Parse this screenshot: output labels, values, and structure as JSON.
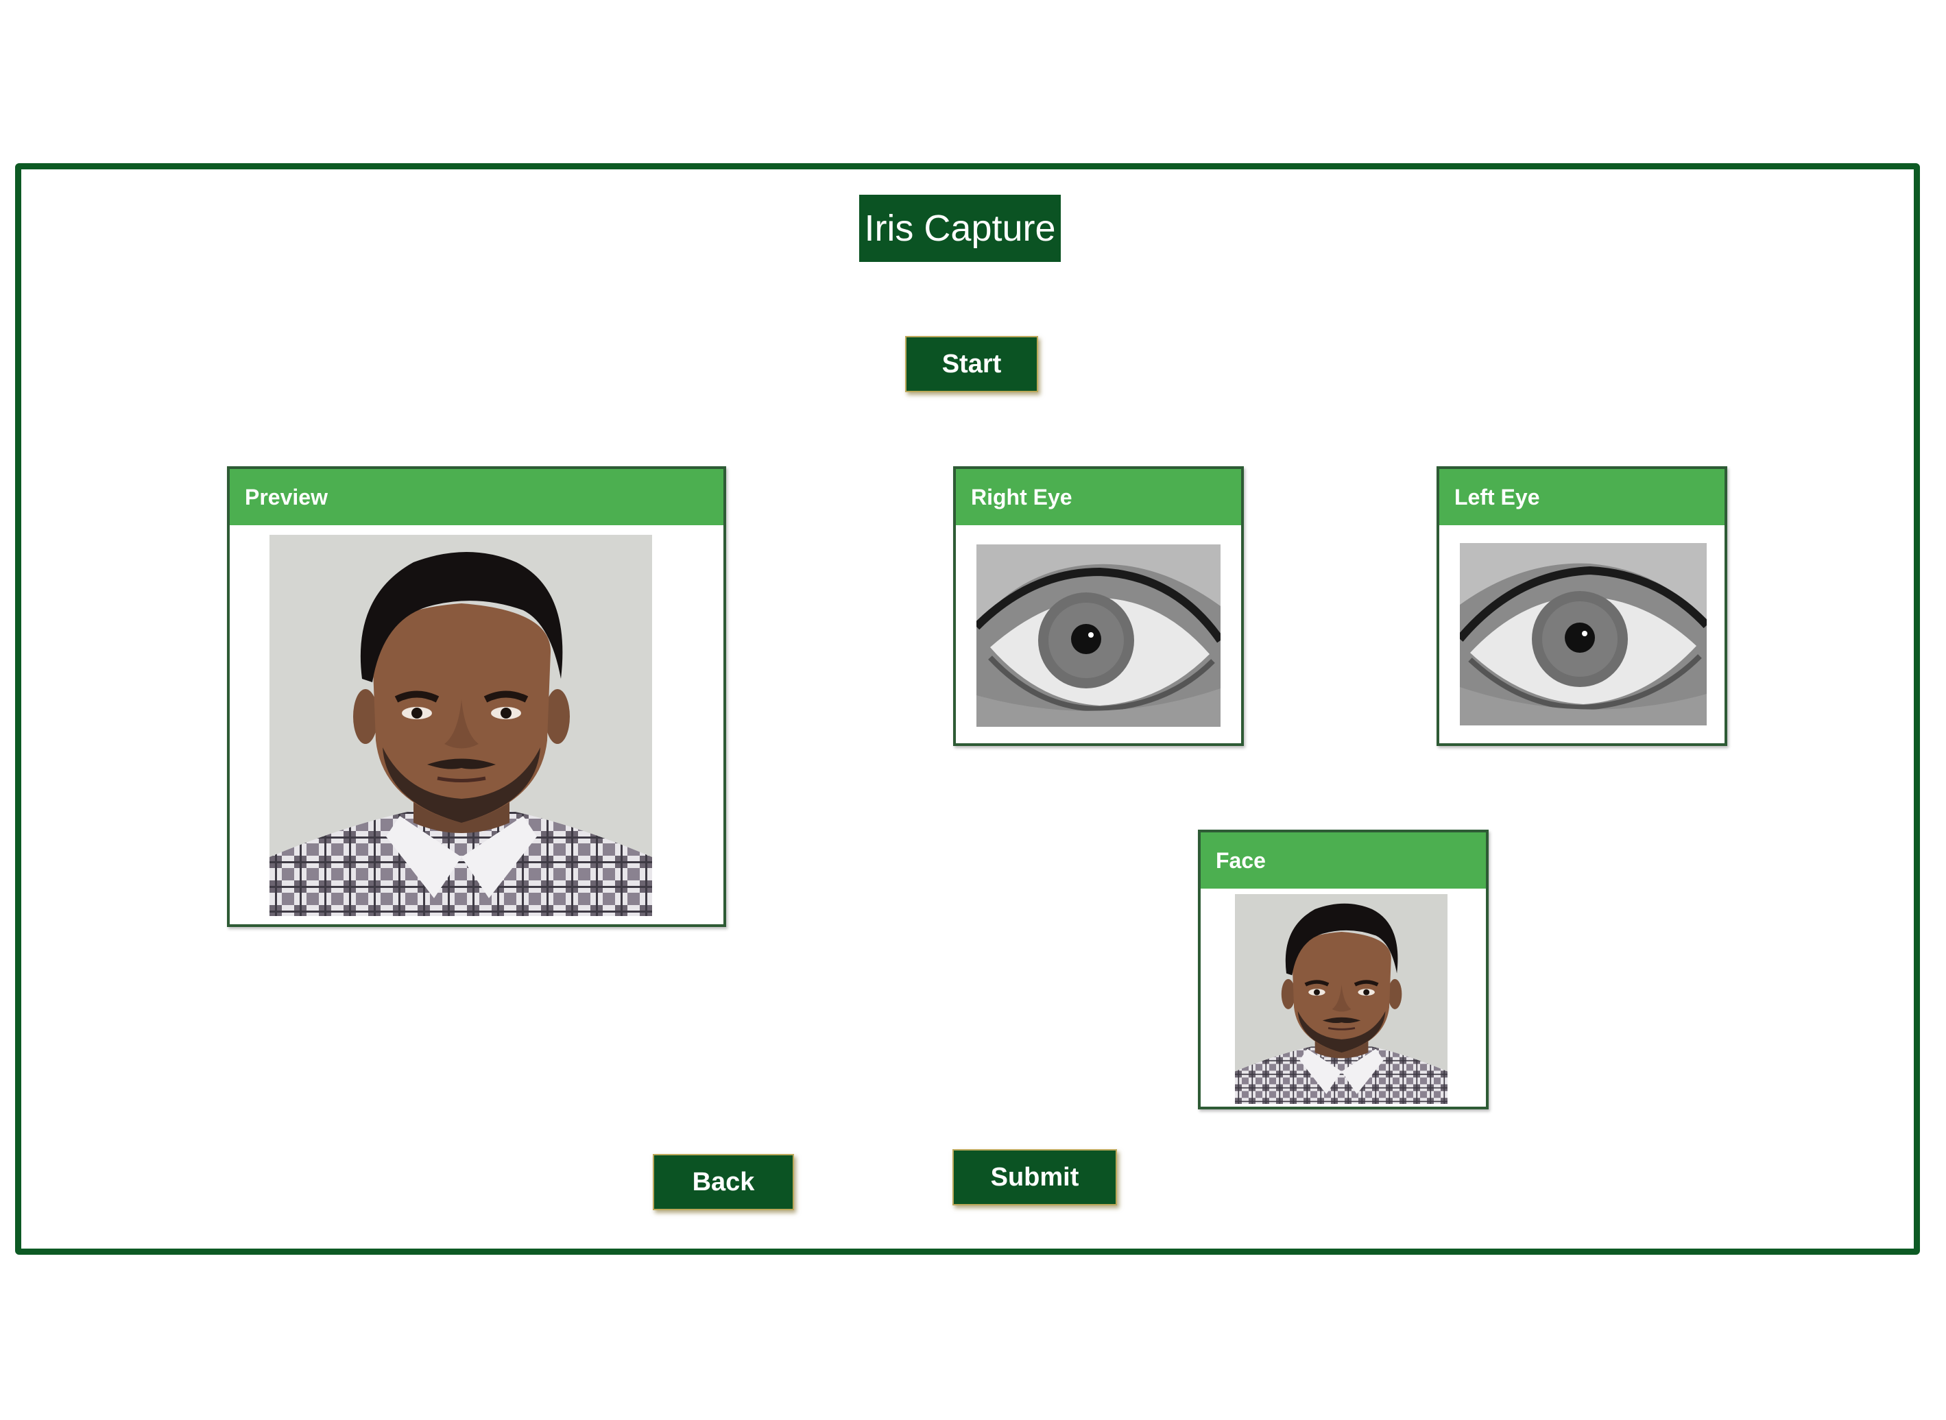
{
  "title": "Iris Capture",
  "buttons": {
    "start": "Start",
    "back": "Back",
    "submit": "Submit"
  },
  "panels": {
    "preview": "Preview",
    "right_eye": "Right Eye",
    "left_eye": "Left Eye",
    "face": "Face"
  },
  "colors": {
    "frame_border": "#0d5a24",
    "dark_green": "#0b5323",
    "header_green": "#4caf50",
    "button_border": "#bca85a"
  }
}
